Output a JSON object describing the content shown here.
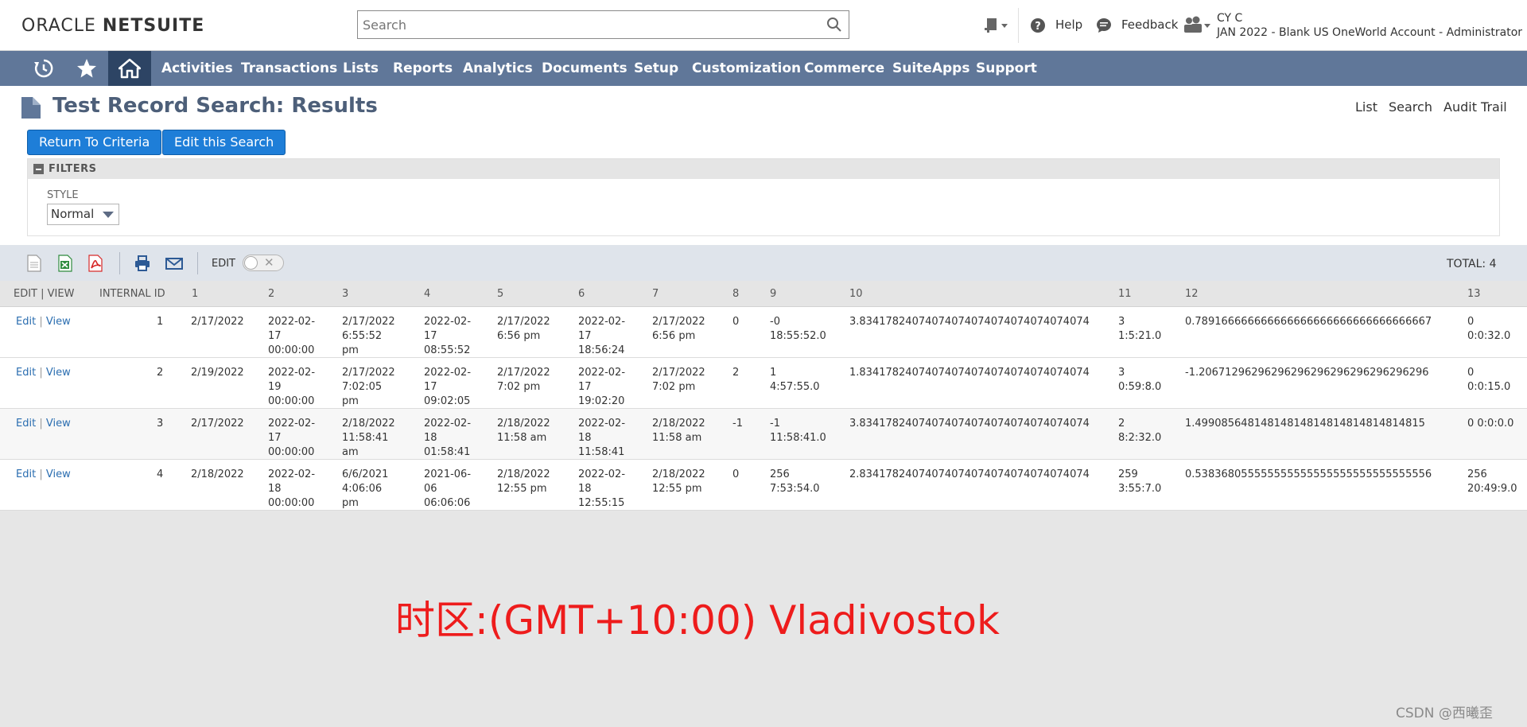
{
  "header": {
    "logo_light": "ORACLE ",
    "logo_bold": "NETSUITE",
    "search_placeholder": "Search",
    "help_label": "Help",
    "feedback_label": "Feedback",
    "user_name": "CY C",
    "account_desc": "JAN 2022 - Blank US OneWorld Account - Administrator"
  },
  "nav": {
    "items": [
      "Activities",
      "Transactions",
      "Lists",
      "Reports",
      "Analytics",
      "Documents",
      "Setup",
      "Customization",
      "Commerce",
      "SuiteApps",
      "Support"
    ]
  },
  "page": {
    "title": "Test Record Search: Results",
    "links": [
      "List",
      "Search",
      "Audit Trail"
    ],
    "return_button": "Return To Criteria",
    "edit_button": "Edit this Search"
  },
  "filters": {
    "title": "FILTERS",
    "style_label": "STYLE",
    "style_value": "Normal"
  },
  "toolbar": {
    "edit_label": "EDIT",
    "total_label": "TOTAL: 4"
  },
  "table": {
    "headers": [
      "EDIT | VIEW",
      "INTERNAL ID",
      "1",
      "2",
      "3",
      "4",
      "5",
      "6",
      "7",
      "8",
      "9",
      "10",
      "11",
      "12",
      "13"
    ],
    "edit_label": "Edit",
    "view_label": "View",
    "rows": [
      {
        "id": "1",
        "c1": "2/17/2022",
        "c2": [
          "2022-02-",
          "17",
          "00:00:00"
        ],
        "c3": [
          "2/17/2022",
          "6:55:52",
          "pm"
        ],
        "c4": [
          "2022-02-",
          "17",
          "08:55:52"
        ],
        "c5": [
          "2/17/2022",
          "6:56 pm"
        ],
        "c6": [
          "2022-02-",
          "17",
          "18:56:24"
        ],
        "c7": [
          "2/17/2022",
          "6:56 pm"
        ],
        "c8": "0",
        "c9": [
          "-0",
          "18:55:52.0"
        ],
        "c10": "3.83417824074074074074074074074074074",
        "c11": [
          "3",
          "1:5:21.0"
        ],
        "c12": "0.789166666666666666666666666666666667",
        "c13": [
          "0",
          "0:0:32.0"
        ]
      },
      {
        "id": "2",
        "c1": "2/19/2022",
        "c2": [
          "2022-02-",
          "19",
          "00:00:00"
        ],
        "c3": [
          "2/17/2022",
          "7:02:05",
          "pm"
        ],
        "c4": [
          "2022-02-",
          "17",
          "09:02:05"
        ],
        "c5": [
          "2/17/2022",
          "7:02 pm"
        ],
        "c6": [
          "2022-02-",
          "17",
          "19:02:20"
        ],
        "c7": [
          "2/17/2022",
          "7:02 pm"
        ],
        "c8": "2",
        "c9": [
          "1",
          "4:57:55.0"
        ],
        "c10": "1.83417824074074074074074074074074074",
        "c11": [
          "3",
          "0:59:8.0"
        ],
        "c12": "-1.20671296296296296296296296296296296",
        "c13": [
          "0",
          "0:0:15.0"
        ]
      },
      {
        "id": "3",
        "c1": "2/17/2022",
        "c2": [
          "2022-02-",
          "17",
          "00:00:00"
        ],
        "c3": [
          "2/18/2022",
          "11:58:41",
          "am"
        ],
        "c4": [
          "2022-02-",
          "18",
          "01:58:41"
        ],
        "c5": [
          "2/18/2022",
          "11:58 am"
        ],
        "c6": [
          "2022-02-",
          "18",
          "11:58:41"
        ],
        "c7": [
          "2/18/2022",
          "11:58 am"
        ],
        "c8": "-1",
        "c9": [
          "-1",
          "11:58:41.0"
        ],
        "c10": "3.83417824074074074074074074074074074",
        "c11": [
          "2",
          "8:2:32.0"
        ],
        "c12": "1.49908564814814814814814814814814815",
        "c13": [
          "0 0:0:0.0"
        ]
      },
      {
        "id": "4",
        "c1": "2/18/2022",
        "c2": [
          "2022-02-",
          "18",
          "00:00:00"
        ],
        "c3": [
          "6/6/2021",
          "4:06:06",
          "pm"
        ],
        "c4": [
          "2021-06-",
          "06",
          "06:06:06"
        ],
        "c5": [
          "2/18/2022",
          "12:55 pm"
        ],
        "c6": [
          "2022-02-",
          "18",
          "12:55:15"
        ],
        "c7": [
          "2/18/2022",
          "12:55 pm"
        ],
        "c8": "0",
        "c9": [
          "256",
          "7:53:54.0"
        ],
        "c10": "2.83417824074074074074074074074074074",
        "c11": [
          "259",
          "3:55:7.0"
        ],
        "c12": "0.538368055555555555555555555555555556",
        "c13": [
          "256",
          "20:49:9.0"
        ]
      }
    ]
  },
  "annotation": "时区:(GMT+10:00) Vladivostok",
  "watermark": "CSDN @西曦歪",
  "colors": {
    "nav_bg": "#607799",
    "nav_home_bg": "#2d4464",
    "button_blue": "#1e7ed8",
    "title_color": "#4d5f79",
    "annotation_red": "#ee1c1c"
  },
  "icons": [
    "create-new-icon",
    "help-icon",
    "feedback-icon",
    "role-icon",
    "recent-icon",
    "star-icon",
    "home-icon",
    "search-icon",
    "document-icon",
    "csv-icon",
    "excel-icon",
    "pdf-icon",
    "print-icon",
    "email-icon"
  ]
}
